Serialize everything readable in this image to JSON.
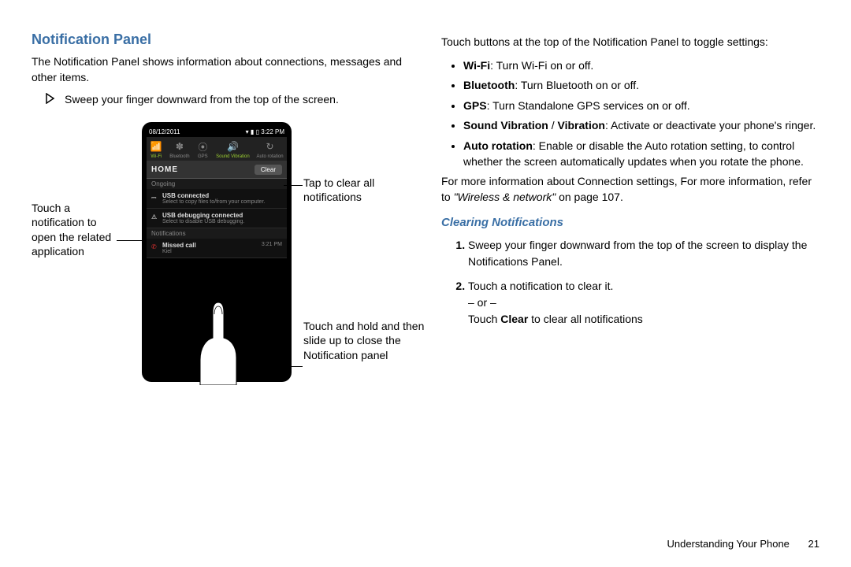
{
  "left": {
    "heading": "Notification Panel",
    "intro": "The Notification Panel shows information about connections, messages and other items.",
    "step": "Sweep your finger downward from the top of the screen.",
    "callout_open": "Touch a notification to open the related application",
    "callout_clear": "Tap to clear all notifications",
    "callout_close": "Touch and hold and then slide up to close the Notification panel"
  },
  "phone": {
    "date": "08/12/2011",
    "time": "3:22 PM",
    "toggles": [
      "Wi-Fi",
      "Bluetooth",
      "GPS",
      "Sound Vibration",
      "Auto rotation"
    ],
    "home": "HOME",
    "clear": "Clear",
    "section_ongoing": "Ongoing",
    "usb_connected": "USB connected",
    "usb_connected_sub": "Select to copy files to/from your computer.",
    "usb_debug": "USB debugging connected",
    "usb_debug_sub": "Select to disable USB debugging.",
    "section_notifications": "Notifications",
    "missed": "Missed call",
    "missed_sub": "Kiel",
    "missed_time": "3:21 PM"
  },
  "right": {
    "toggle_intro": "Touch buttons at the top of the Notification Panel to toggle settings:",
    "settings": [
      {
        "b": "Wi-Fi",
        "t": ": Turn Wi-Fi on or off."
      },
      {
        "b": "Bluetooth",
        "t": ": Turn Bluetooth on or off."
      },
      {
        "b": "GPS",
        "t": ": Turn Standalone GPS services on or off."
      },
      {
        "b": "Sound Vibration",
        "b2": "Vibration",
        "sep": " / ",
        "t": ": Activate or deactivate your phone's ringer."
      },
      {
        "b": "Auto rotation",
        "t": ": Enable or disable the Auto rotation setting, to control whether the screen automatically updates when you rotate the phone."
      }
    ],
    "more_info_pre": "For more information about Connection settings, For more information, refer to ",
    "more_info_ref": "\"Wireless & network\"",
    "more_info_post": " on page 107.",
    "clearing_heading": "Clearing Notifications",
    "steps": {
      "s1": "Sweep your finger downward from the top of the screen to display the Notifications Panel.",
      "s2a": "Touch a notification to clear it.",
      "s2or": "– or –",
      "s2b_pre": "Touch ",
      "s2b_bold": "Clear",
      "s2b_post": " to clear all notifications"
    }
  },
  "footer": {
    "title": "Understanding Your Phone",
    "page": "21"
  }
}
